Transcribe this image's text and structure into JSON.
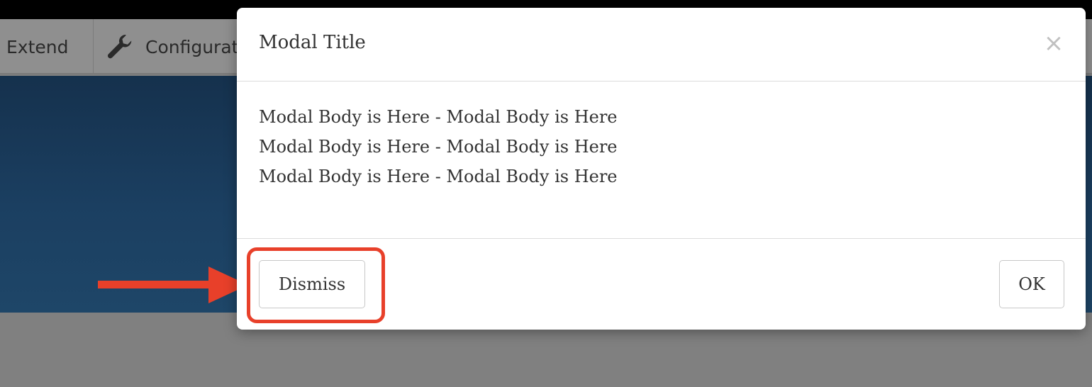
{
  "toolbar": {
    "items": [
      {
        "label": "Extend",
        "icon": null
      },
      {
        "label": "Configurat",
        "icon": "wrench-icon"
      }
    ]
  },
  "modal": {
    "title": "Modal Title",
    "close_glyph": "×",
    "body_lines": [
      "Modal Body is Here - Modal Body is Here",
      "Modal Body is Here - Modal Body is Here",
      "Modal Body is Here - Modal Body is Here"
    ],
    "buttons": {
      "dismiss": "Dismiss",
      "ok": "OK"
    }
  },
  "colors": {
    "annotation": "#e8402a",
    "hero": "#1b3f61",
    "overlay": "#808080"
  }
}
